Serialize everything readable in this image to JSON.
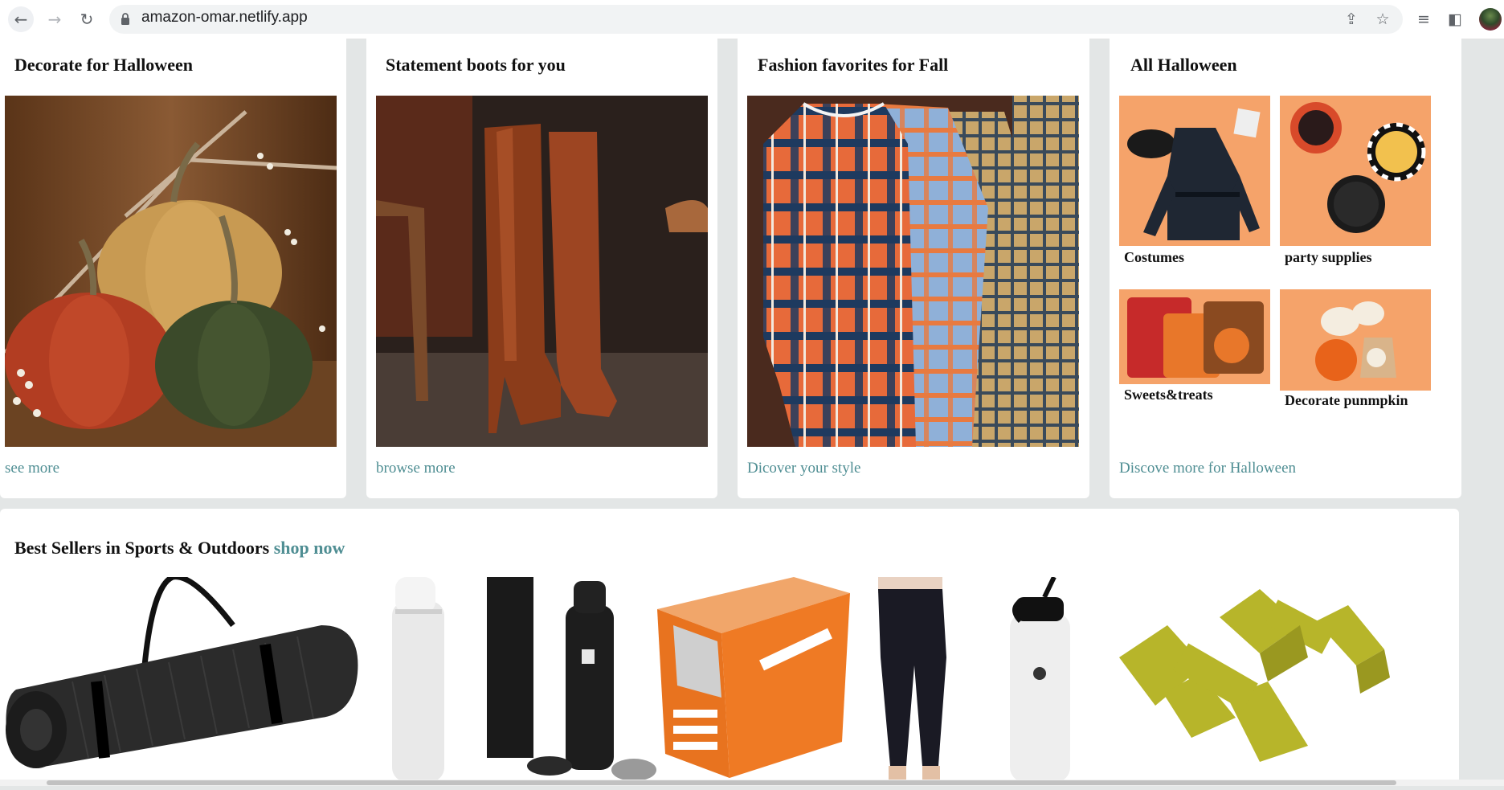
{
  "browser": {
    "url": "amazon-omar.netlify.app",
    "back_glyph": "←",
    "forward_glyph": "→",
    "reload_glyph": "↻",
    "share_glyph": "⇪",
    "star_glyph": "☆",
    "menu_glyph": "≡",
    "sidepanel_glyph": "◧"
  },
  "cards": [
    {
      "title": "Decorate for Halloween",
      "link": "see more",
      "image": "velvet-pumpkins"
    },
    {
      "title": "Statement boots for you",
      "link": "browse more",
      "image": "brown-leather-boots"
    },
    {
      "title": "Fashion favorites for Fall",
      "link": "Dicover your style",
      "image": "plaid-shirts"
    },
    {
      "title": "All Halloween",
      "link": "Discove more for Halloween",
      "tiles": [
        {
          "label": "Costumes",
          "image": "black-coat-costume"
        },
        {
          "label": "party supplies",
          "image": "halloween-plates"
        },
        {
          "label": "Sweets&treats",
          "image": "candy-bags"
        },
        {
          "label": "Decorate punmpkin",
          "image": "white-pumpkins"
        }
      ]
    }
  ],
  "best_sellers": {
    "title": "Best Sellers in Sports & Outdoors",
    "link": "shop now",
    "products": [
      "yoga-mat",
      "owala-bottle",
      "ironflask-bottle",
      "hand-warmers-box",
      "black-joggers",
      "hydro-flask",
      "green-dumbbells"
    ]
  },
  "colors": {
    "page_bg": "#e3e6e6",
    "link": "#4f8e93",
    "card_bg": "#ffffff"
  }
}
